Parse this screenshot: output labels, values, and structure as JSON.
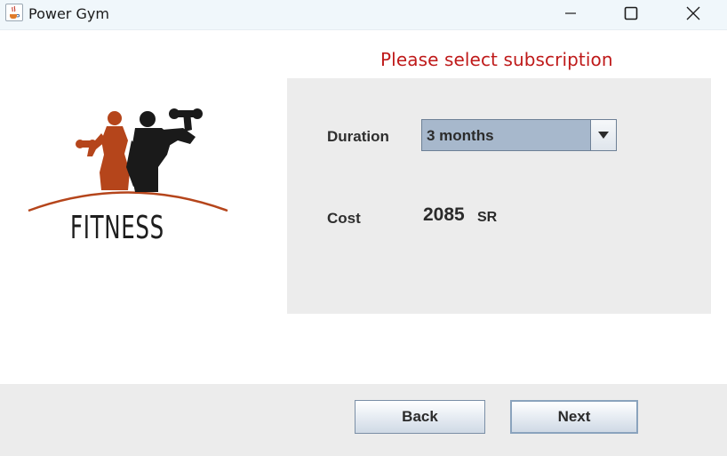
{
  "window": {
    "title": "Power Gym",
    "app_icon": "java-coffee-icon",
    "controls": {
      "minimize": "minimize-icon",
      "maximize": "maximize-icon",
      "close": "close-icon"
    }
  },
  "main": {
    "heading": "Please select subscription",
    "logo": {
      "text": "FITNESS",
      "colors": {
        "figure_female": "#b5451b",
        "figure_male": "#1a1a1a",
        "arc": "#b5451b"
      }
    },
    "duration": {
      "label": "Duration",
      "selected": "3 months"
    },
    "cost": {
      "label": "Cost",
      "value": "2085",
      "unit": "SR"
    }
  },
  "footer": {
    "back_label": "Back",
    "next_label": "Next"
  },
  "colors": {
    "heading": "#bf1a1a",
    "panel": "#ececec",
    "combo": "#a7b8cc"
  }
}
